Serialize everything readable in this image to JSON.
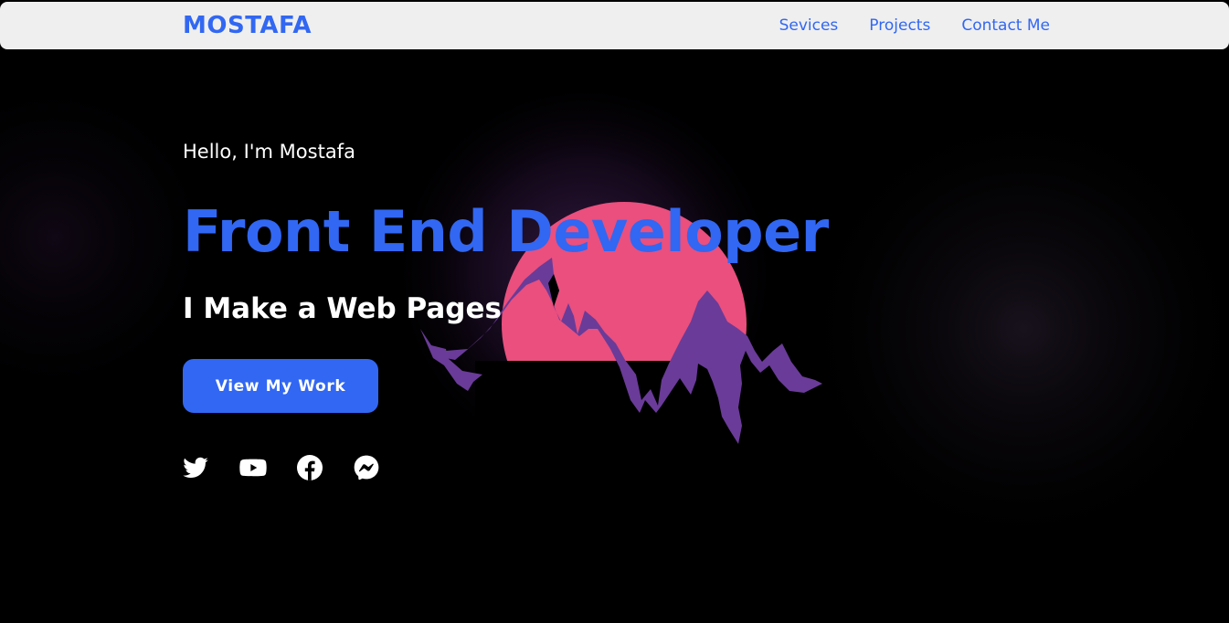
{
  "navbar": {
    "brand": "MOSTAFA",
    "links": [
      {
        "label": "Sevices"
      },
      {
        "label": "Projects"
      },
      {
        "label": "Contact Me"
      }
    ]
  },
  "hero": {
    "greeting": "Hello, I'm Mostafa",
    "headline": "Front End Developer",
    "subhead": "I Make a Web Pages",
    "cta_label": "View My Work"
  },
  "socials": [
    {
      "icon": "twitter-icon"
    },
    {
      "icon": "youtube-icon"
    },
    {
      "icon": "facebook-icon"
    },
    {
      "icon": "messenger-icon"
    }
  ],
  "colors": {
    "accent": "#3167f2",
    "navbar_bg": "#efefef",
    "background": "#000000",
    "sun": "#ea4f7e",
    "mountain": "#6a3b98"
  }
}
